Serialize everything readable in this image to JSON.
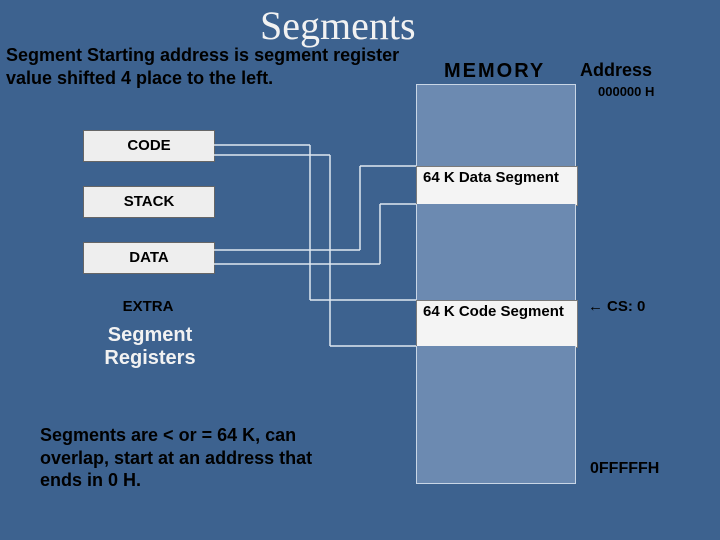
{
  "title": "Segments",
  "subtitle": "Segment Starting address is segment register value shifted 4 place to the left.",
  "memory_label": "MEMORY",
  "address_label": "Address",
  "addresses": {
    "top": "000000 H",
    "cs": "CS: 0",
    "bottom": "0FFFFFH"
  },
  "memory_blocks": {
    "data_segment": "64 K Data Segment",
    "code_segment": "64 K Code Segment"
  },
  "registers": {
    "code": "CODE",
    "stack": "STACK",
    "data": "DATA",
    "extra": "EXTRA"
  },
  "registers_caption": "Segment Registers",
  "footnote": "Segments are < or = 64 K, can overlap, start at an address that ends in 0 H.",
  "arrow_glyph": "←"
}
